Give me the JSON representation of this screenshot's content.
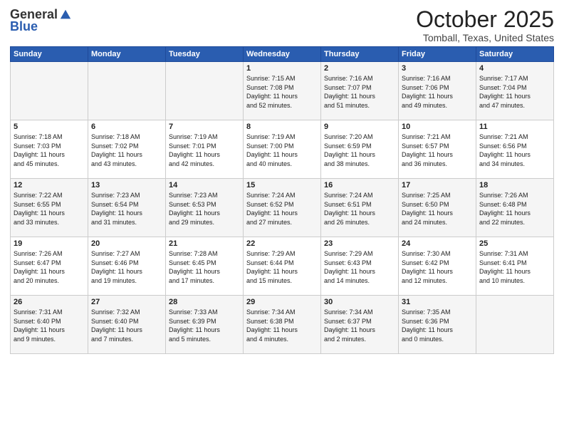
{
  "logo": {
    "general": "General",
    "blue": "Blue"
  },
  "header": {
    "month": "October 2025",
    "location": "Tomball, Texas, United States"
  },
  "weekdays": [
    "Sunday",
    "Monday",
    "Tuesday",
    "Wednesday",
    "Thursday",
    "Friday",
    "Saturday"
  ],
  "weeks": [
    [
      {
        "day": "",
        "info": ""
      },
      {
        "day": "",
        "info": ""
      },
      {
        "day": "",
        "info": ""
      },
      {
        "day": "1",
        "info": "Sunrise: 7:15 AM\nSunset: 7:08 PM\nDaylight: 11 hours\nand 52 minutes."
      },
      {
        "day": "2",
        "info": "Sunrise: 7:16 AM\nSunset: 7:07 PM\nDaylight: 11 hours\nand 51 minutes."
      },
      {
        "day": "3",
        "info": "Sunrise: 7:16 AM\nSunset: 7:06 PM\nDaylight: 11 hours\nand 49 minutes."
      },
      {
        "day": "4",
        "info": "Sunrise: 7:17 AM\nSunset: 7:04 PM\nDaylight: 11 hours\nand 47 minutes."
      }
    ],
    [
      {
        "day": "5",
        "info": "Sunrise: 7:18 AM\nSunset: 7:03 PM\nDaylight: 11 hours\nand 45 minutes."
      },
      {
        "day": "6",
        "info": "Sunrise: 7:18 AM\nSunset: 7:02 PM\nDaylight: 11 hours\nand 43 minutes."
      },
      {
        "day": "7",
        "info": "Sunrise: 7:19 AM\nSunset: 7:01 PM\nDaylight: 11 hours\nand 42 minutes."
      },
      {
        "day": "8",
        "info": "Sunrise: 7:19 AM\nSunset: 7:00 PM\nDaylight: 11 hours\nand 40 minutes."
      },
      {
        "day": "9",
        "info": "Sunrise: 7:20 AM\nSunset: 6:59 PM\nDaylight: 11 hours\nand 38 minutes."
      },
      {
        "day": "10",
        "info": "Sunrise: 7:21 AM\nSunset: 6:57 PM\nDaylight: 11 hours\nand 36 minutes."
      },
      {
        "day": "11",
        "info": "Sunrise: 7:21 AM\nSunset: 6:56 PM\nDaylight: 11 hours\nand 34 minutes."
      }
    ],
    [
      {
        "day": "12",
        "info": "Sunrise: 7:22 AM\nSunset: 6:55 PM\nDaylight: 11 hours\nand 33 minutes."
      },
      {
        "day": "13",
        "info": "Sunrise: 7:23 AM\nSunset: 6:54 PM\nDaylight: 11 hours\nand 31 minutes."
      },
      {
        "day": "14",
        "info": "Sunrise: 7:23 AM\nSunset: 6:53 PM\nDaylight: 11 hours\nand 29 minutes."
      },
      {
        "day": "15",
        "info": "Sunrise: 7:24 AM\nSunset: 6:52 PM\nDaylight: 11 hours\nand 27 minutes."
      },
      {
        "day": "16",
        "info": "Sunrise: 7:24 AM\nSunset: 6:51 PM\nDaylight: 11 hours\nand 26 minutes."
      },
      {
        "day": "17",
        "info": "Sunrise: 7:25 AM\nSunset: 6:50 PM\nDaylight: 11 hours\nand 24 minutes."
      },
      {
        "day": "18",
        "info": "Sunrise: 7:26 AM\nSunset: 6:48 PM\nDaylight: 11 hours\nand 22 minutes."
      }
    ],
    [
      {
        "day": "19",
        "info": "Sunrise: 7:26 AM\nSunset: 6:47 PM\nDaylight: 11 hours\nand 20 minutes."
      },
      {
        "day": "20",
        "info": "Sunrise: 7:27 AM\nSunset: 6:46 PM\nDaylight: 11 hours\nand 19 minutes."
      },
      {
        "day": "21",
        "info": "Sunrise: 7:28 AM\nSunset: 6:45 PM\nDaylight: 11 hours\nand 17 minutes."
      },
      {
        "day": "22",
        "info": "Sunrise: 7:29 AM\nSunset: 6:44 PM\nDaylight: 11 hours\nand 15 minutes."
      },
      {
        "day": "23",
        "info": "Sunrise: 7:29 AM\nSunset: 6:43 PM\nDaylight: 11 hours\nand 14 minutes."
      },
      {
        "day": "24",
        "info": "Sunrise: 7:30 AM\nSunset: 6:42 PM\nDaylight: 11 hours\nand 12 minutes."
      },
      {
        "day": "25",
        "info": "Sunrise: 7:31 AM\nSunset: 6:41 PM\nDaylight: 11 hours\nand 10 minutes."
      }
    ],
    [
      {
        "day": "26",
        "info": "Sunrise: 7:31 AM\nSunset: 6:40 PM\nDaylight: 11 hours\nand 9 minutes."
      },
      {
        "day": "27",
        "info": "Sunrise: 7:32 AM\nSunset: 6:40 PM\nDaylight: 11 hours\nand 7 minutes."
      },
      {
        "day": "28",
        "info": "Sunrise: 7:33 AM\nSunset: 6:39 PM\nDaylight: 11 hours\nand 5 minutes."
      },
      {
        "day": "29",
        "info": "Sunrise: 7:34 AM\nSunset: 6:38 PM\nDaylight: 11 hours\nand 4 minutes."
      },
      {
        "day": "30",
        "info": "Sunrise: 7:34 AM\nSunset: 6:37 PM\nDaylight: 11 hours\nand 2 minutes."
      },
      {
        "day": "31",
        "info": "Sunrise: 7:35 AM\nSunset: 6:36 PM\nDaylight: 11 hours\nand 0 minutes."
      },
      {
        "day": "",
        "info": ""
      }
    ]
  ]
}
